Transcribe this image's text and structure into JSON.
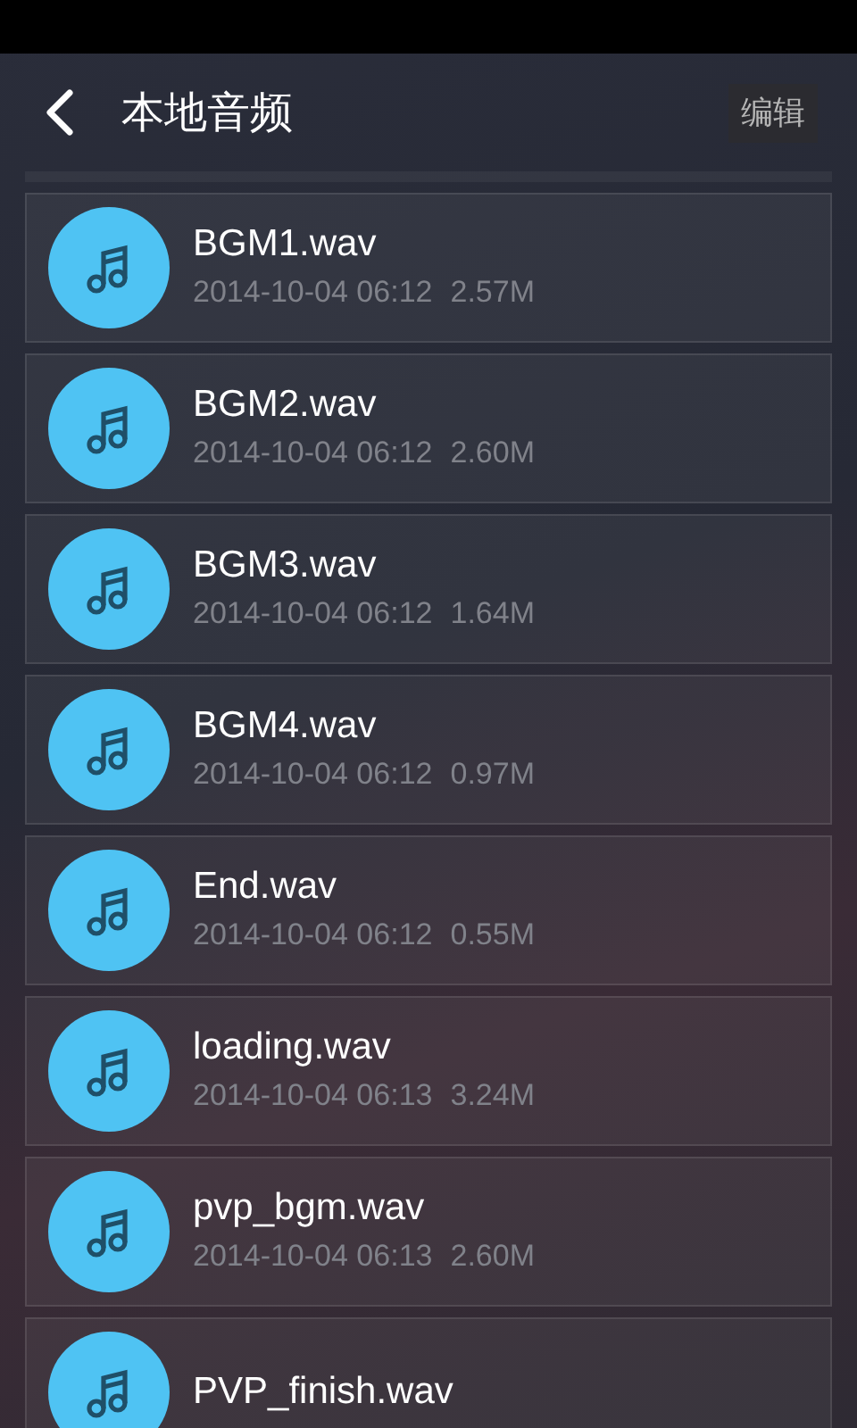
{
  "header": {
    "title": "本地音频",
    "edit_button": "编辑"
  },
  "files": [
    {
      "name": "BGM1.wav",
      "date": "2014-10-04 06:12",
      "size": "2.57M"
    },
    {
      "name": "BGM2.wav",
      "date": "2014-10-04 06:12",
      "size": "2.60M"
    },
    {
      "name": "BGM3.wav",
      "date": "2014-10-04 06:12",
      "size": "1.64M"
    },
    {
      "name": "BGM4.wav",
      "date": "2014-10-04 06:12",
      "size": "0.97M"
    },
    {
      "name": "End.wav",
      "date": "2014-10-04 06:12",
      "size": "0.55M"
    },
    {
      "name": "loading.wav",
      "date": "2014-10-04 06:13",
      "size": "3.24M"
    },
    {
      "name": "pvp_bgm.wav",
      "date": "2014-10-04 06:13",
      "size": "2.60M"
    },
    {
      "name": "PVP_finish.wav"
    }
  ]
}
